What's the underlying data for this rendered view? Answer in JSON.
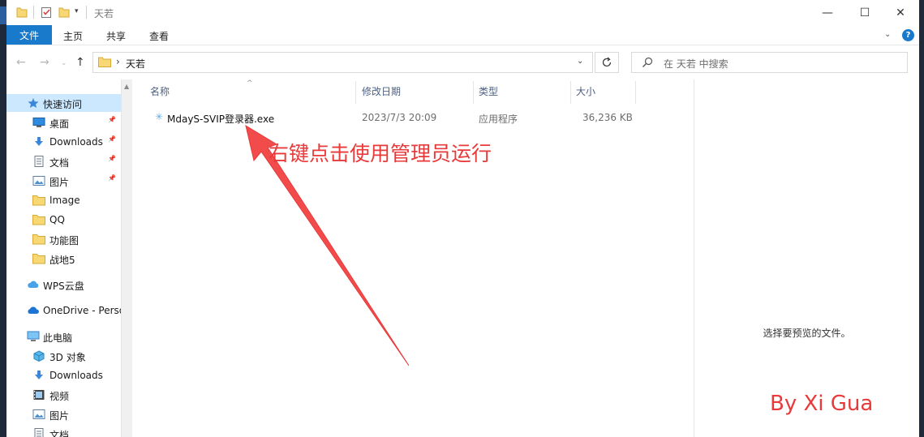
{
  "window": {
    "title": "天若",
    "minimize": "—",
    "maximize": "☐",
    "close": "✕"
  },
  "ribbon": {
    "tabs": [
      "文件",
      "主页",
      "共享",
      "查看"
    ],
    "help": "?"
  },
  "address": {
    "separator": "›",
    "path": "天若",
    "search_placeholder": "在 天若 中搜索"
  },
  "sidebar": {
    "items": [
      {
        "label": "快速访问",
        "icon": "star-icon",
        "pinned": false,
        "selected": true
      },
      {
        "label": "桌面",
        "icon": "desktop-icon",
        "pinned": true
      },
      {
        "label": "Downloads",
        "icon": "download-icon",
        "pinned": true
      },
      {
        "label": "文档",
        "icon": "document-icon",
        "pinned": true
      },
      {
        "label": "图片",
        "icon": "picture-icon",
        "pinned": true
      },
      {
        "label": "Image",
        "icon": "folder-icon",
        "pinned": false
      },
      {
        "label": "QQ",
        "icon": "folder-icon",
        "pinned": false
      },
      {
        "label": "功能图",
        "icon": "folder-icon",
        "pinned": false
      },
      {
        "label": "战地5",
        "icon": "folder-icon",
        "pinned": false
      },
      {
        "label": "WPS云盘",
        "icon": "cloud-icon",
        "pinned": false
      },
      {
        "label": "OneDrive - Perso",
        "icon": "onedrive-icon",
        "pinned": false
      },
      {
        "label": "此电脑",
        "icon": "computer-icon",
        "pinned": false
      },
      {
        "label": "3D 对象",
        "icon": "cube-icon",
        "pinned": false
      },
      {
        "label": "Downloads",
        "icon": "download-icon",
        "pinned": false
      },
      {
        "label": "视频",
        "icon": "video-icon",
        "pinned": false
      },
      {
        "label": "图片",
        "icon": "picture-icon",
        "pinned": false
      },
      {
        "label": "文档",
        "icon": "document-icon",
        "pinned": false
      }
    ]
  },
  "columns": [
    "名称",
    "修改日期",
    "类型",
    "大小"
  ],
  "files": [
    {
      "name": "MdayS-SVIP登录器.exe",
      "modified": "2023/7/3 20:09",
      "type": "应用程序",
      "size": "36,236 KB"
    }
  ],
  "preview": {
    "message": "选择要预览的文件。"
  },
  "annotation": {
    "text": "右键点击使用管理员运行",
    "color": "#e83a3a"
  },
  "watermark": {
    "text": "By Xi Gua"
  },
  "colors": {
    "accent": "#1979ca",
    "selection": "#cce8ff",
    "folder": "#f8d775"
  }
}
